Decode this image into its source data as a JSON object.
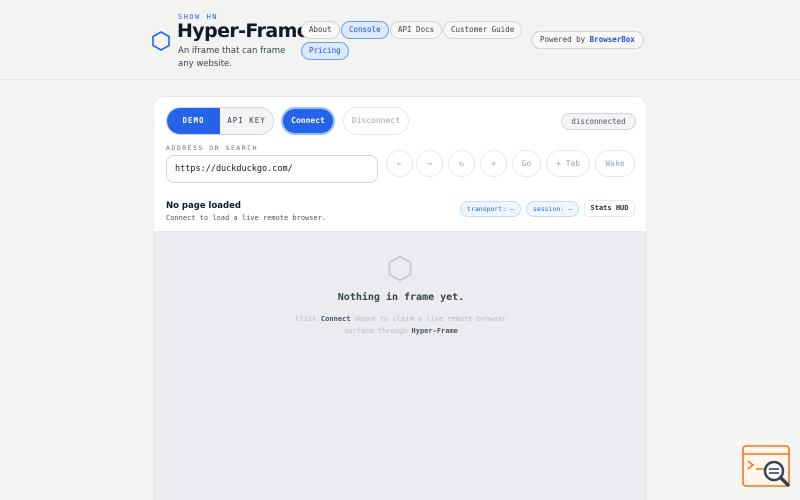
{
  "header": {
    "eyebrow": "SHOW HN",
    "title": "Hyper-Frame",
    "subtitle": "An iframe that can frame any website.",
    "nav": [
      {
        "label": "About",
        "active": false
      },
      {
        "label": "Console",
        "active": true
      },
      {
        "label": "API Docs",
        "active": false
      },
      {
        "label": "Customer Guide",
        "active": false
      },
      {
        "label": "Pricing",
        "active": true
      }
    ],
    "powered_prefix": "Powered by ",
    "powered_brand": "BrowserBox"
  },
  "controls": {
    "mode_demo": "DEMO",
    "mode_api": "API KEY",
    "connect": "Connect",
    "disconnect": "Disconnect",
    "status": "disconnected"
  },
  "address": {
    "label": "ADDRESS OR SEARCH",
    "value": "https://duckduckgo.com/",
    "buttons": {
      "back": "←",
      "forward": "→",
      "reload": "↻",
      "stop": "×",
      "go": "Go",
      "new_tab": "+ Tab",
      "wake": "Wake"
    }
  },
  "info": {
    "title": "No page loaded",
    "subtitle": "Connect to load a live remote browser.",
    "transport": "transport: —",
    "session": "session: —",
    "stats_hud": "Stats HUD"
  },
  "empty_state": {
    "title": "Nothing in frame yet.",
    "text_1": "Click ",
    "text_connect": "Connect",
    "text_2": " above to claim a live remote browser surface through ",
    "text_brand": "Hyper-Frame"
  },
  "colors": {
    "accent": "#2563eb",
    "accent_light": "#dbeafe",
    "background": "#f5f5f4",
    "panel": "#ffffff"
  },
  "icons": [
    "hexagon-logo-icon",
    "hexagon-placeholder-icon",
    "search-assistant-icon"
  ]
}
